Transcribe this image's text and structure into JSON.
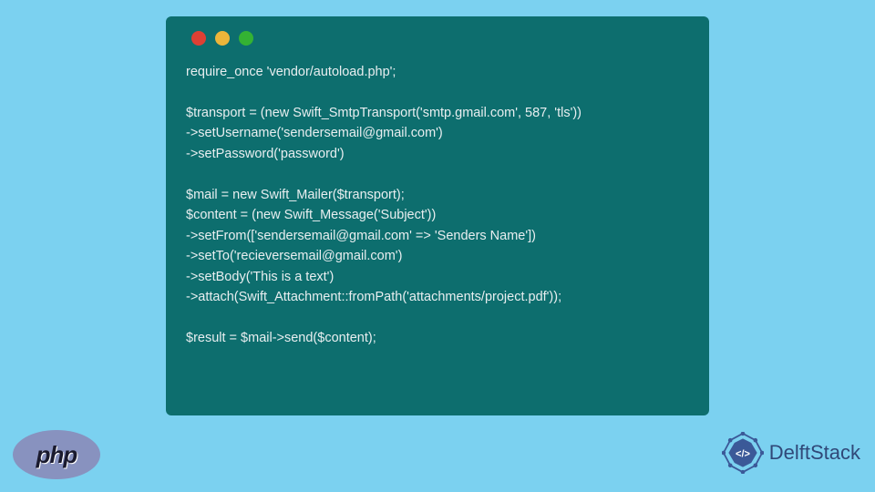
{
  "code": {
    "line1": "require_once 'vendor/autoload.php';",
    "line2": "",
    "line3": "$transport = (new Swift_SmtpTransport('smtp.gmail.com', 587, 'tls'))",
    "line4": "->setUsername('sendersemail@gmail.com')",
    "line5": "->setPassword('password')",
    "line6": "",
    "line7": "$mail = new Swift_Mailer($transport);",
    "line8": "$content = (new Swift_Message('Subject'))",
    "line9": "->setFrom(['sendersemail@gmail.com' => 'Senders Name'])",
    "line10": "->setTo('recieversemail@gmail.com')",
    "line11": "->setBody('This is a text')",
    "line12": "->attach(Swift_Attachment::fromPath('attachments/project.pdf'));",
    "line13": "",
    "line14": "$result = $mail->send($content);"
  },
  "php_logo_text": "php",
  "delft_text": "DelftStack"
}
